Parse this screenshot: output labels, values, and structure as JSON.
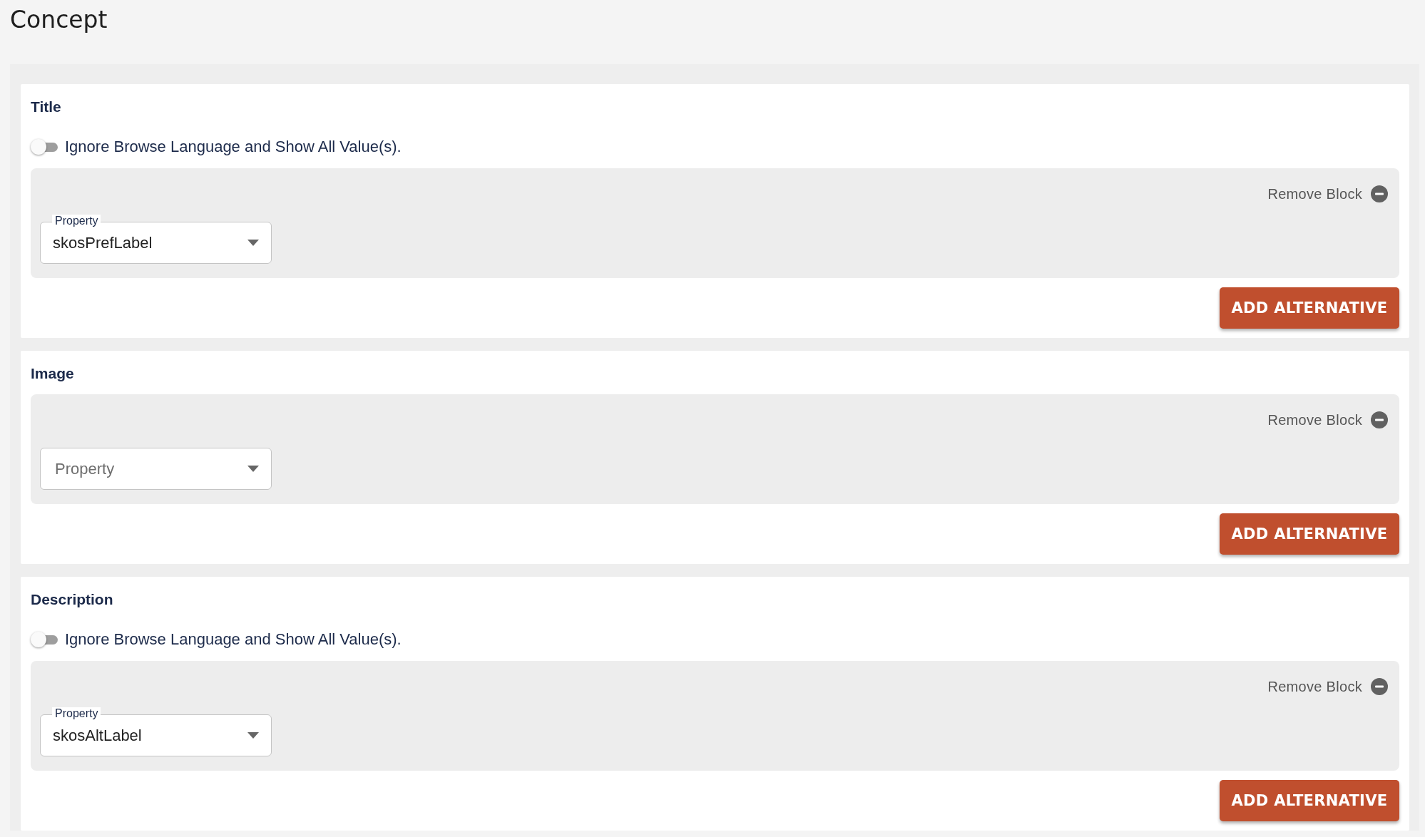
{
  "heading": "Concept",
  "sections": [
    {
      "title": "Title",
      "toggle": {
        "label": "Ignore Browse Language and Show All Value(s).",
        "on": false
      },
      "blocks": [
        {
          "remove_label": "Remove Block",
          "property": {
            "label": "Property",
            "value": "skosPrefLabel"
          }
        }
      ],
      "add_button": "ADD ALTERNATIVE"
    },
    {
      "title": "Image",
      "blocks": [
        {
          "remove_label": "Remove Block",
          "property": {
            "placeholder": "Property"
          }
        }
      ],
      "add_button": "ADD ALTERNATIVE"
    },
    {
      "title": "Description",
      "toggle": {
        "label": "Ignore Browse Language and Show All Value(s).",
        "on": false
      },
      "blocks": [
        {
          "remove_label": "Remove Block",
          "property": {
            "label": "Property",
            "value": "skosAltLabel"
          }
        }
      ],
      "add_button": "ADD ALTERNATIVE"
    }
  ]
}
